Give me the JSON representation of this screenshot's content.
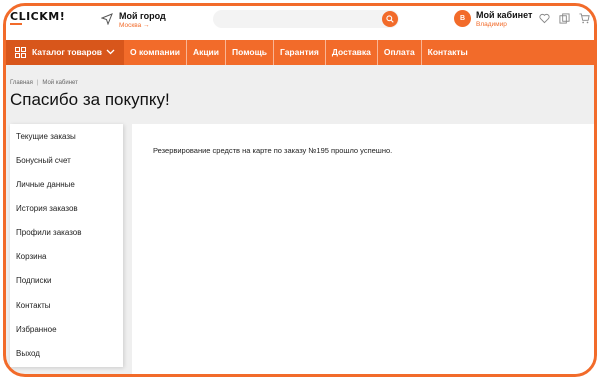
{
  "header": {
    "logo_text": "CLICKM!",
    "city": {
      "title": "Мой город",
      "subtitle": "Москва →"
    },
    "search": {
      "placeholder": ""
    },
    "cabinet": {
      "avatar_letter": "В",
      "title": "Мой кабинет",
      "subtitle": "Владимир"
    }
  },
  "nav": {
    "catalog_label": "Каталог товаров",
    "items": [
      "О компании",
      "Акции",
      "Помощь",
      "Гарантия",
      "Доставка",
      "Оплата",
      "Контакты"
    ]
  },
  "breadcrumb": [
    "Главная",
    "Мой кабинет"
  ],
  "page_title": "Спасибо за покупку!",
  "sidebar": {
    "items": [
      "Текущие заказы",
      "Бонусный счет",
      "Личные данные",
      "История заказов",
      "Профили заказов",
      "Корзина",
      "Подписки",
      "Контакты",
      "Избранное",
      "Выход"
    ]
  },
  "content": {
    "message": "Резервирование средств на карте по заказу №195 прошло успешно."
  },
  "colors": {
    "accent": "#f26b2a",
    "accent_dark": "#d8561b",
    "page_bg": "#efefef"
  }
}
